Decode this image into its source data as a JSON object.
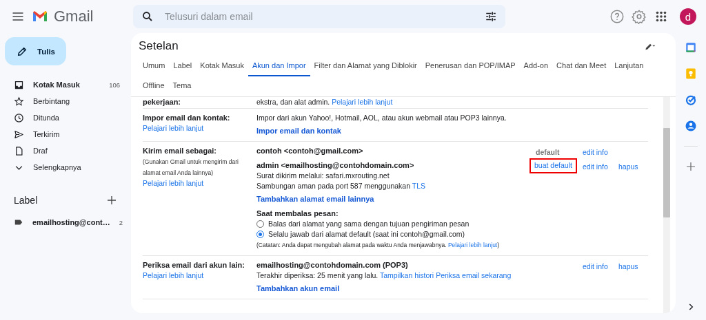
{
  "topbar": {
    "app_name": "Gmail",
    "search_placeholder": "Telusuri dalam email",
    "avatar_letter": "d"
  },
  "compose": {
    "label": "Tulis"
  },
  "sidebar": {
    "items": [
      {
        "kind": "inbox",
        "label": "Kotak Masuk",
        "count": "106",
        "unread": true
      },
      {
        "kind": "star",
        "label": "Berbintang",
        "unread": false
      },
      {
        "kind": "clock",
        "label": "Ditunda",
        "unread": false
      },
      {
        "kind": "send",
        "label": "Terkirim",
        "unread": false
      },
      {
        "kind": "draft",
        "label": "Draf",
        "unread": false
      },
      {
        "kind": "more",
        "label": "Selengkapnya",
        "unread": false
      }
    ],
    "labels_title": "Label",
    "labels": [
      {
        "label": "emailhosting@cont…",
        "count": "2",
        "unread": true
      }
    ]
  },
  "settings": {
    "title": "Setelan",
    "tabs": [
      {
        "label": "Umum",
        "selected": false
      },
      {
        "label": "Label",
        "selected": false
      },
      {
        "label": "Kotak Masuk",
        "selected": false
      },
      {
        "label": "Akun dan Impor",
        "selected": true
      },
      {
        "label": "Filter dan Alamat yang Diblokir",
        "selected": false
      },
      {
        "label": "Penerusan dan POP/IMAP",
        "selected": false
      },
      {
        "label": "Add-on",
        "selected": false
      },
      {
        "label": "Chat dan Meet",
        "selected": false
      },
      {
        "label": "Lanjutan",
        "selected": false
      },
      {
        "label": "Offline",
        "selected": false
      },
      {
        "label": "Tema",
        "selected": false
      }
    ],
    "rows": [
      {
        "title": "pekerjaan:",
        "content": [
          {
            "kind": "text",
            "text": "ekstra, dan alat admin.",
            "links": [
              "Pelajari lebih lanjut"
            ]
          }
        ]
      },
      {
        "title": "Impor email dan kontak:",
        "link": "Pelajari lebih lanjut",
        "content": [
          {
            "kind": "text",
            "text": "Impor dari akun Yahoo!, Hotmail, AOL, atau akun webmail atau POP3 lainnya."
          },
          {
            "kind": "action",
            "text": "Impor email dan kontak"
          }
        ]
      },
      {
        "title": "Kirim email sebagai:",
        "note": "(Gunakan Gmail untuk mengirim dari alamat email Anda lainnya)",
        "link": "Pelajari lebih lanjut",
        "content": [
          {
            "kind": "account",
            "address": "contoh <contoh@gmail.com>",
            "actions": [
              {
                "kind": "status",
                "text": "default"
              },
              {
                "kind": "edit",
                "text": "edit info"
              }
            ]
          },
          {
            "kind": "account",
            "address": "admin <emailhosting@contohdomain.com>",
            "details": [
              {
                "text": "Surat dikirim melalui: safari.mxrouting.net"
              },
              {
                "text": "Sambungan aman pada port 587 menggunakan",
                "links": [
                  "TLS"
                ]
              }
            ],
            "actions": [
              {
                "kind": "make-default",
                "text": "buat default",
                "highlighted": true
              },
              {
                "kind": "edit",
                "text": "edit info"
              },
              {
                "kind": "delete",
                "text": "hapus"
              }
            ]
          },
          {
            "kind": "action",
            "text": "Tambahkan alamat email lainnya"
          },
          {
            "kind": "reply-options",
            "title": "Saat membalas pesan:",
            "options": [
              {
                "label": "Balas dari alamat yang sama dengan tujuan pengiriman pesan",
                "selected": false
              },
              {
                "label": "Selalu jawab dari alamat default (saat ini contoh@gmail.com)",
                "selected": true
              }
            ],
            "note": {
              "text": "(Catatan: Anda dapat mengubah alamat pada waktu Anda menjawabnya.",
              "links": [
                "Pelajari lebih lanjut"
              ],
              "after": ")"
            }
          }
        ]
      },
      {
        "title": "Periksa email dari akun lain:",
        "link": "Pelajari lebih lanjut",
        "content": [
          {
            "kind": "account",
            "address": "emailhosting@contohdomain.com (POP3)",
            "details": [
              {
                "text": "Terakhir diperiksa: 25 menit yang lalu.",
                "links": [
                  "Tampilkan histori",
                  "Periksa email sekarang"
                ]
              }
            ],
            "actions": [
              {
                "kind": "edit",
                "text": "edit info"
              },
              {
                "kind": "delete",
                "text": "hapus"
              }
            ]
          },
          {
            "kind": "action",
            "text": "Tambahkan akun email"
          }
        ]
      }
    ]
  }
}
